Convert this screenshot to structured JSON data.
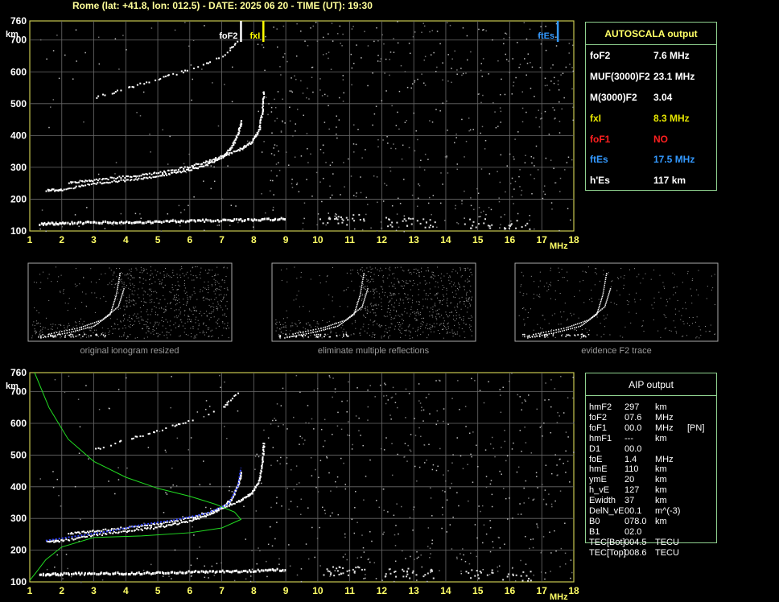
{
  "header": {
    "title": "Rome (lat: +41.8, lon: 012.5) - DATE: 2025 06 20 - TIME (UT): 19:30"
  },
  "chart_data": [
    {
      "type": "scatter",
      "name_hint": "main ionogram",
      "xlabel": "MHz",
      "ylabel": "km",
      "xlim": [
        1,
        18
      ],
      "ylim": [
        100,
        760
      ],
      "x_ticks": [
        "1",
        "2",
        "3",
        "4",
        "5",
        "6",
        "7",
        "8",
        "9",
        "10",
        "11",
        "12",
        "13",
        "14",
        "15",
        "16",
        "17",
        "18"
      ],
      "y_ticks": [
        "100",
        "200",
        "300",
        "400",
        "500",
        "600",
        "700",
        "760"
      ],
      "grid": true,
      "markers": [
        {
          "label": "foF2",
          "x": 7.6,
          "color": "#ffffff"
        },
        {
          "label": "fxI",
          "x": 8.3,
          "color": "#ffff00"
        },
        {
          "label": "ftEs",
          "x": 17.5,
          "color": "#3399ff"
        }
      ],
      "traces": [
        {
          "name": "o-trace",
          "points": [
            [
              1.5,
              230
            ],
            [
              2,
              232
            ],
            [
              3,
              250
            ],
            [
              4,
              262
            ],
            [
              5,
              275
            ],
            [
              5.8,
              290
            ],
            [
              6.5,
              310
            ],
            [
              7,
              335
            ],
            [
              7.3,
              365
            ],
            [
              7.5,
              410
            ],
            [
              7.6,
              450
            ]
          ]
        },
        {
          "name": "x-trace",
          "points": [
            [
              2.2,
              255
            ],
            [
              3,
              262
            ],
            [
              4,
              273
            ],
            [
              5,
              285
            ],
            [
              6,
              305
            ],
            [
              6.8,
              330
            ],
            [
              7.5,
              355
            ],
            [
              7.9,
              380
            ],
            [
              8.15,
              420
            ],
            [
              8.25,
              480
            ],
            [
              8.3,
              545
            ]
          ]
        },
        {
          "name": "multiple",
          "points": [
            [
              3,
              520
            ],
            [
              4,
              550
            ],
            [
              5,
              580
            ],
            [
              6,
              610
            ],
            [
              7,
              650
            ],
            [
              7.5,
              700
            ]
          ]
        },
        {
          "name": "Es",
          "points": [
            [
              1.3,
              125
            ],
            [
              2,
              128
            ],
            [
              3,
              130
            ],
            [
              4,
              130
            ],
            [
              5,
              132
            ],
            [
              6,
              135
            ],
            [
              7,
              137
            ],
            [
              8,
              138
            ],
            [
              9,
              142
            ]
          ]
        }
      ]
    },
    {
      "type": "scatter",
      "name_hint": "AIP ionogram",
      "xlabel": "MHz",
      "ylabel": "km",
      "xlim": [
        1,
        18
      ],
      "ylim": [
        100,
        760
      ],
      "x_ticks": [
        "1",
        "2",
        "3",
        "4",
        "5",
        "6",
        "7",
        "8",
        "9",
        "10",
        "11",
        "12",
        "13",
        "14",
        "15",
        "16",
        "17",
        "18"
      ],
      "y_ticks": [
        "100",
        "200",
        "300",
        "400",
        "500",
        "600",
        "700",
        "760"
      ],
      "grid": true,
      "profile_green": [
        [
          1.15,
          760
        ],
        [
          1.6,
          650
        ],
        [
          2.2,
          550
        ],
        [
          3,
          480
        ],
        [
          4,
          430
        ],
        [
          5,
          395
        ],
        [
          6,
          370
        ],
        [
          6.8,
          345
        ],
        [
          7.4,
          320
        ],
        [
          7.6,
          297
        ],
        [
          7,
          270
        ],
        [
          6,
          255
        ],
        [
          4.5,
          245
        ],
        [
          3,
          240
        ],
        [
          2,
          210
        ],
        [
          1.5,
          170
        ],
        [
          1.2,
          130
        ],
        [
          1.0,
          105
        ]
      ],
      "profile_blue": [
        [
          1.5,
          230
        ],
        [
          2.5,
          245
        ],
        [
          3.5,
          260
        ],
        [
          4.5,
          280
        ],
        [
          5.5,
          295
        ],
        [
          6.5,
          315
        ],
        [
          7.2,
          345
        ],
        [
          7.5,
          400
        ],
        [
          7.6,
          460
        ]
      ]
    }
  ],
  "autoscala": {
    "title": "AUTOSCALA output",
    "rows": [
      {
        "label": "foF2",
        "value": "7.6 MHz",
        "color": "#ffffff"
      },
      {
        "label": "MUF(3000)F2",
        "value": "23.1 MHz",
        "color": "#ffffff"
      },
      {
        "label": "M(3000)F2",
        "value": "3.04",
        "color": "#ffffff"
      },
      {
        "label": "fxI",
        "value": "8.3 MHz",
        "color": "#e6e600"
      },
      {
        "label": "foF1",
        "value": "NO",
        "color": "#ff2020"
      },
      {
        "label": "ftEs",
        "value": "17.5 MHz",
        "color": "#3399ff"
      },
      {
        "label": "h'Es",
        "value": "117    km",
        "color": "#ffffff"
      }
    ]
  },
  "thumbnails": [
    {
      "caption": "original ionogram resized"
    },
    {
      "caption": "eliminate multiple reflections"
    },
    {
      "caption": "evidence F2 trace"
    }
  ],
  "aip": {
    "title": "AIP output",
    "rows": [
      [
        "hmF2",
        "297",
        "km",
        ""
      ],
      [
        "foF2",
        "07.6",
        "MHz",
        ""
      ],
      [
        "foF1",
        "00.0",
        "MHz",
        "[PN]"
      ],
      [
        "hmF1",
        "---",
        "km",
        ""
      ],
      [
        "D1",
        "00.0",
        "",
        ""
      ],
      [
        "foE",
        "1.4",
        "MHz",
        ""
      ],
      [
        "hmE",
        "110",
        "km",
        ""
      ],
      [
        "ymE",
        "20",
        "km",
        ""
      ],
      [
        "h_vE",
        "127",
        "km",
        ""
      ],
      [
        "Ewidth",
        "37",
        "km",
        ""
      ],
      [
        "DelN_vE",
        "00.1",
        "m^(-3)",
        ""
      ],
      [
        "B0",
        "078.0",
        "km",
        ""
      ],
      [
        "B1",
        "02.0",
        "",
        ""
      ],
      [
        "TEC[Bot]",
        "004.5",
        "TECU",
        ""
      ],
      [
        "TEC[Top]",
        "008.6",
        "TECU",
        ""
      ]
    ]
  }
}
